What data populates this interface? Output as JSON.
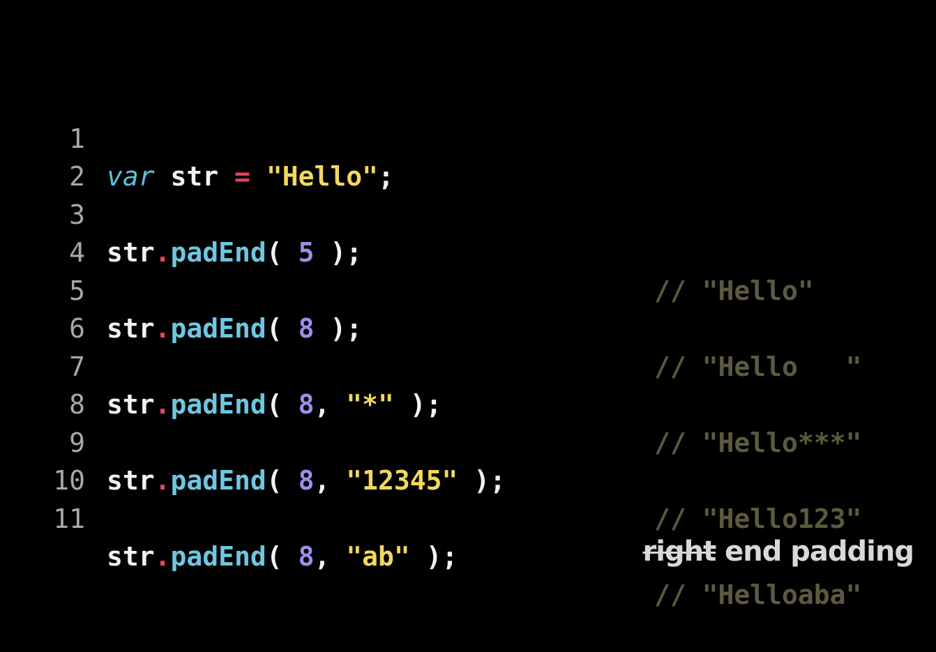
{
  "lines": [
    {
      "num": "1",
      "parts": {
        "kw": "var",
        "var": " str ",
        "op": "=",
        "space": " ",
        "str": "\"Hello\"",
        "end": ";"
      },
      "comment": ""
    },
    {
      "num": "2"
    },
    {
      "num": "3",
      "obj": "str",
      "dot": ".",
      "method": "padEnd",
      "open": "( ",
      "n": "5",
      "rest1": "",
      "arg": "",
      "close": " );",
      "comment": "// \"Hello\""
    },
    {
      "num": "4"
    },
    {
      "num": "5",
      "obj": "str",
      "dot": ".",
      "method": "padEnd",
      "open": "( ",
      "n": "8",
      "rest1": "",
      "arg": "",
      "close": " );",
      "comment": "// \"Hello   \""
    },
    {
      "num": "6"
    },
    {
      "num": "7",
      "obj": "str",
      "dot": ".",
      "method": "padEnd",
      "open": "( ",
      "n": "8",
      "rest1": ", ",
      "arg": "\"*\"",
      "close": " );",
      "comment": "// \"Hello***\""
    },
    {
      "num": "8"
    },
    {
      "num": "9",
      "obj": "str",
      "dot": ".",
      "method": "padEnd",
      "open": "( ",
      "n": "8",
      "rest1": ", ",
      "arg": "\"12345\"",
      "close": " );",
      "comment": "// \"Hello123\""
    },
    {
      "num": "10"
    },
    {
      "num": "11",
      "obj": "str",
      "dot": ".",
      "method": "padEnd",
      "open": "( ",
      "n": "8",
      "rest1": ", ",
      "arg": "\"ab\"",
      "close": " );",
      "comment": "// \"Helloaba\""
    }
  ],
  "caption": {
    "struck": "right",
    "text": " end padding"
  },
  "colors": {
    "background": "#000000",
    "keyword": "#5bc0d8",
    "operator": "#e8435a",
    "string": "#f0d860",
    "method": "#6fc6e0",
    "number": "#a08ce8",
    "comment": "#5c5a3e",
    "line_number": "#a8a8a8"
  }
}
